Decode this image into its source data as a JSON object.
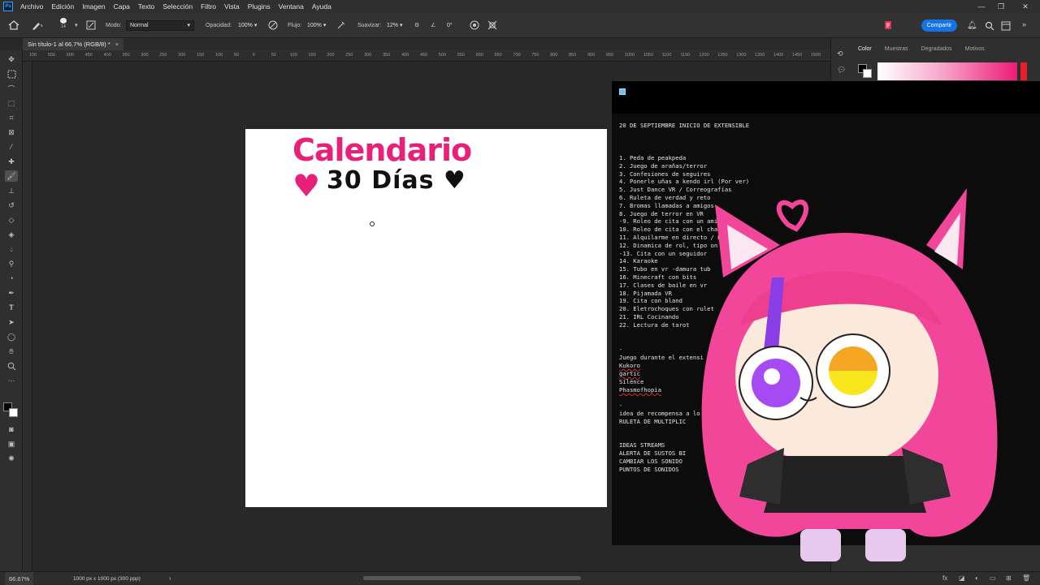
{
  "menu": {
    "logo": "Ps",
    "items": [
      "Archivo",
      "Edición",
      "Imagen",
      "Capa",
      "Texto",
      "Selección",
      "Filtro",
      "Vista",
      "Plugins",
      "Ventana",
      "Ayuda"
    ]
  },
  "options": {
    "brush_size": "14",
    "mode_label": "Modo:",
    "mode_value": "Normal",
    "opacity_label": "Opacidad:",
    "opacity_value": "100%",
    "flow_label": "Flujo:",
    "flow_value": "100%",
    "smooth_label": "Suavizar:",
    "smooth_value": "12%",
    "angle_value": "0°",
    "share_label": "Compartir"
  },
  "document": {
    "tab_title": "Sin título-1 al 66.7% (RGB/8) *",
    "close_glyph": "×"
  },
  "ruler_ticks": [
    "100",
    "550",
    "500",
    "450",
    "400",
    "350",
    "300",
    "250",
    "200",
    "150",
    "100",
    "50",
    "0",
    "50",
    "100",
    "150",
    "200",
    "250",
    "300",
    "350",
    "400",
    "450",
    "500",
    "550",
    "600",
    "650",
    "700",
    "750",
    "800",
    "850",
    "900",
    "950",
    "1000",
    "1050",
    "1100",
    "1150",
    "1200",
    "1250",
    "1300",
    "1350",
    "1400",
    "1450",
    "1500",
    "1550"
  ],
  "canvas": {
    "title": "Calendario ♥",
    "subtitle": "30 Días ♥"
  },
  "panel": {
    "tabs": [
      "Color",
      "Muestras",
      "Degradados",
      "Motivos"
    ],
    "active_tab": "Color"
  },
  "notes": {
    "header": "20 DE SEPTIEMBRE INICIO DE EXTENSIBLE",
    "items": [
      "1. Peda de peakpeda",
      "2. Juego de arañas/terror",
      "3. Confesiones  de seguires",
      "4. Ponerle uñas a kendo irl (Por ver)",
      "5. Just Dance VR /  Correografías",
      "6. Ruleta de verdad y reto",
      "7. Bromas llamadas a amigos-",
      "8. Juego de terror en VR",
      "-9. Roleo de cita con un amigo",
      "10. Roleo de cita con el chat",
      "11. Alquilarme en directo / E",
      "12. Dinamica de rol, tipo on          decirle a ke",
      "-13. Cita con un seguidor",
      "14. Karaoke",
      "15. Tubo en vr -damura tub",
      "16. Minecraft con bits",
      "17. Clases de baile en vr",
      "18. Pijamada VR",
      "19. Cita con bland",
      "20. Eletrochoques con rulet",
      "21. IRL Cocinando",
      "22. Lectura de tarot"
    ],
    "dash1": "-",
    "games_title": "Juego durante el extensi",
    "games": [
      "Kukoro",
      "gartic",
      "Silence",
      "Phasmofhopia"
    ],
    "dash2": "-",
    "reward_lines": [
      "idea de recompensa a lo",
      "RULETA DE MULTIPLIC"
    ],
    "streams_title": "IDEAS STREAMS",
    "streams": [
      "ALERTA DE SUSTOS BI",
      "CAMBIAR LOS SONIDO",
      "PUNTOS DE SONIDOS"
    ]
  },
  "status": {
    "zoom": "66.67%",
    "dims": "1000 px x 1000 px (300 ppp)",
    "arrow": "›"
  },
  "colors": {
    "accent": "#1473e6",
    "title_pink": "#e8207a",
    "spell_red": "#d32f2f"
  }
}
